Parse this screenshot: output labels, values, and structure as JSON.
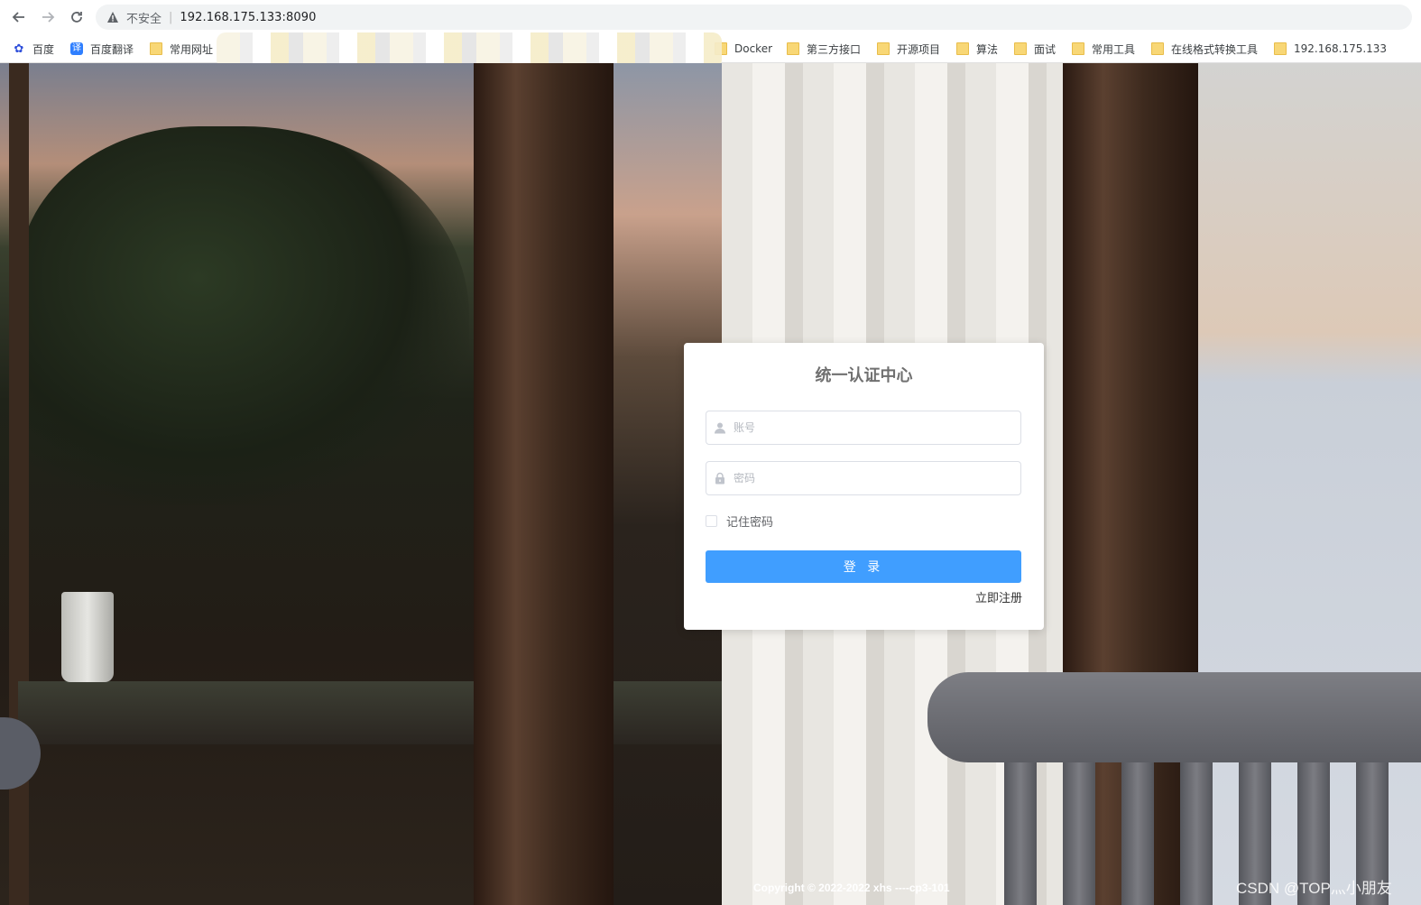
{
  "browser": {
    "security_label": "不安全",
    "separator": "|",
    "url": "192.168.175.133:8090"
  },
  "bookmarks": [
    {
      "label": "百度",
      "icon": "baidu-icon"
    },
    {
      "label": "百度翻译",
      "icon": "fanyi-icon"
    },
    {
      "label": "常用网址",
      "icon": "folder-icon"
    },
    {
      "label": "Docker",
      "icon": "folder-icon"
    },
    {
      "label": "第三方接口",
      "icon": "folder-icon"
    },
    {
      "label": "开源项目",
      "icon": "folder-icon"
    },
    {
      "label": "算法",
      "icon": "folder-icon"
    },
    {
      "label": "面试",
      "icon": "folder-icon"
    },
    {
      "label": "常用工具",
      "icon": "folder-icon"
    },
    {
      "label": "在线格式转换工具",
      "icon": "folder-icon"
    },
    {
      "label": "192.168.175.133",
      "icon": "folder-icon"
    }
  ],
  "login": {
    "title": "统一认证中心",
    "username_placeholder": "账号",
    "password_placeholder": "密码",
    "remember_label": "记住密码",
    "login_button": "登 录",
    "register_link": "立即注册"
  },
  "footer": {
    "copyright": "Copyright © 2022-2022 xhs ----cp3-101"
  },
  "watermark": "CSDN @TOP灬小朋友",
  "colors": {
    "primary": "#409eff",
    "title": "#707070"
  }
}
